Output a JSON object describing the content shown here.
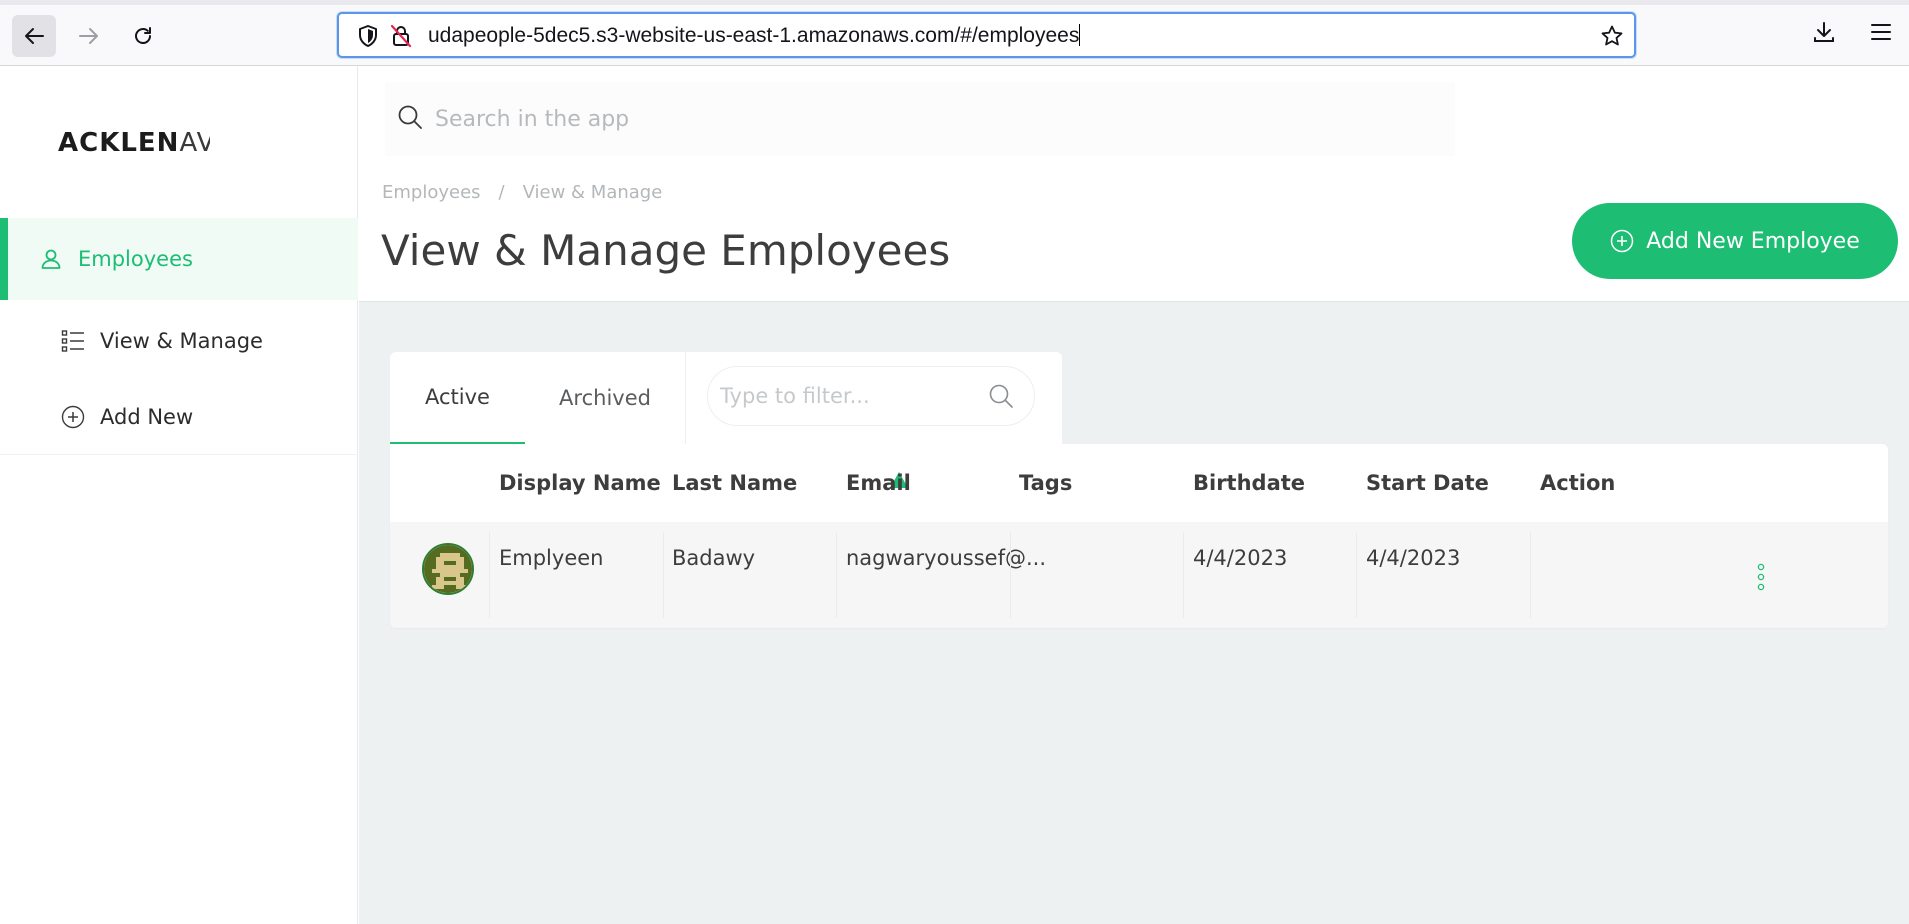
{
  "browser": {
    "url": "udapeople-5dec5.s3-website-us-east-1.amazonaws.com/#/employees",
    "icons": [
      "back-arrow-icon",
      "forward-arrow-icon",
      "reload-icon",
      "shield-icon",
      "insecure-lock-icon",
      "bookmark-star-icon",
      "download-icon",
      "menu-icon"
    ]
  },
  "sidebar": {
    "logo_main": "ACKLEN",
    "logo_tail": "AV",
    "items": [
      {
        "label": "Employees",
        "icon": "user-icon",
        "active": true
      },
      {
        "label": "View & Manage",
        "icon": "list-icon",
        "active": false
      },
      {
        "label": "Add New",
        "icon": "plus-circle-icon",
        "active": false
      }
    ]
  },
  "search": {
    "placeholder": "Search in the app"
  },
  "breadcrumb": {
    "items": [
      "Employees",
      "View & Manage"
    ],
    "separator": "/"
  },
  "page": {
    "title": "View & Manage Employees",
    "add_button_label": "Add New Employee"
  },
  "tabs": [
    {
      "label": "Active",
      "active": true
    },
    {
      "label": "Archived",
      "active": false
    }
  ],
  "filter": {
    "placeholder": "Type to filter..."
  },
  "table": {
    "columns": [
      "Display Name",
      "Last Name",
      "Email",
      "Tags",
      "Birthdate",
      "Start Date",
      "Action"
    ],
    "sorted_column": "Email",
    "sort_direction": "ascending",
    "rows": [
      {
        "display_name": "Emplyeen",
        "last_name": "Badawy",
        "email": "nagwaryoussef@...",
        "tags": "",
        "birthdate": "4/4/2023",
        "start_date": "4/4/2023"
      }
    ]
  },
  "colors": {
    "accent": "#1dbd74",
    "sidebar_active_bg": "#f0fbf6",
    "main_bg": "#eef1f2",
    "urlbar_focus": "#5b97e6"
  }
}
